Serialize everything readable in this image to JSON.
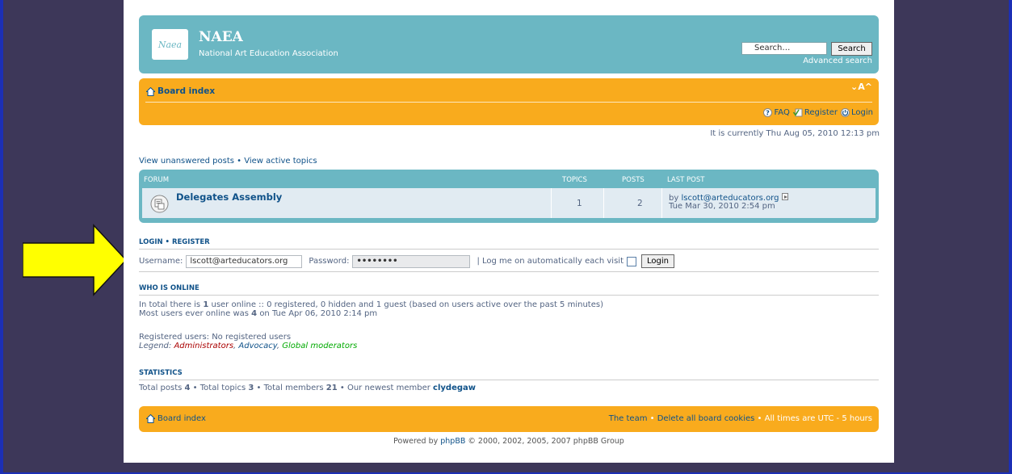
{
  "header": {
    "logo_text": "Naea",
    "site_title": "NAEA",
    "site_description": "National Art Education Association",
    "search_placeholder": "Search…",
    "search_button": "Search",
    "advanced_search": "Advanced search"
  },
  "navbar": {
    "board_index": "Board index",
    "font_resize": "⌄A^",
    "faq": "FAQ",
    "register": "Register",
    "login": "Login"
  },
  "current_time": "It is currently Thu Aug 05, 2010 12:13 pm",
  "quick_links": {
    "unanswered": "View unanswered posts",
    "separator": "•",
    "active": "View active topics"
  },
  "forum_table": {
    "headers": {
      "forum": "Forum",
      "topics": "Topics",
      "posts": "Posts",
      "last_post": "Last post"
    },
    "rows": [
      {
        "name": "Delegates Assembly",
        "topics": "1",
        "posts": "2",
        "last_post_prefix": "by",
        "last_post_author": "lscott@arteducators.org",
        "last_post_date": "Tue Mar 30, 2010 2:54 pm"
      }
    ]
  },
  "login": {
    "heading": "Login • Register",
    "username_label": "Username:",
    "username_value": "lscott@arteducators.org",
    "password_label": "Password:",
    "password_value": "••••••••",
    "autologin_label": "| Log me on automatically each visit",
    "login_button": "Login"
  },
  "who_is_online": {
    "heading": "Who is online",
    "line1_a": "In total there is",
    "line1_count": "1",
    "line1_b": "user online :: 0 registered, 0 hidden and 1 guest (based on users active over the past 5 minutes)",
    "line2_a": "Most users ever online was",
    "line2_count": "4",
    "line2_b": "on Tue Apr 06, 2010 2:14 pm",
    "registered_users": "Registered users: No registered users",
    "legend_label": "Legend:",
    "legend_admin": "Administrators",
    "legend_advocacy": "Advocacy",
    "legend_mods": "Global moderators"
  },
  "statistics": {
    "heading": "Statistics",
    "posts_label": "Total posts",
    "posts": "4",
    "topics_label": "Total topics",
    "topics": "3",
    "members_label": "Total members",
    "members": "21",
    "newest_label": "Our newest member",
    "newest": "clydegaw"
  },
  "footer": {
    "board_index": "Board index",
    "team": "The team",
    "delete_cookies": "Delete all board cookies",
    "timezone": "All times are UTC - 5 hours",
    "powered_prefix": "Powered by",
    "powered_link": "phpBB",
    "powered_suffix": "© 2000, 2002, 2005, 2007 phpBB Group"
  },
  "colors": {
    "header_teal": "#6bb7c3",
    "nav_orange": "#f9ab1d",
    "link_blue": "#105289",
    "background": "#3d3759",
    "arrow_yellow": "#ffff00"
  }
}
